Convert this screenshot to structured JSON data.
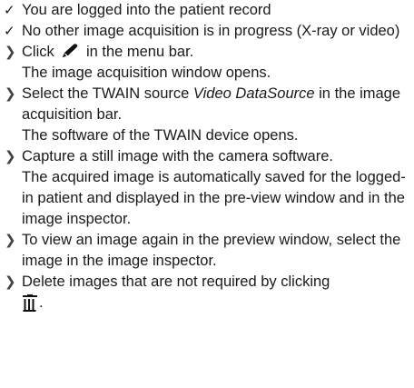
{
  "checks": [
    {
      "icon": "checkmark-icon",
      "text": "You are logged into the patient record"
    },
    {
      "icon": "checkmark-icon",
      "text": "No other image acquisition is in progress (X-ray or video)"
    }
  ],
  "steps": [
    {
      "icon": "chevron-right-icon",
      "before": "Click",
      "inline_icon": "pen-icon",
      "after": "in the menu bar.",
      "result": "The image acquisition window opens."
    },
    {
      "icon": "chevron-right-icon",
      "before": "Select the TWAIN source",
      "emphasis": "Video DataSource",
      "after": "in the image acquisition bar.",
      "result": "The software of the TWAIN device opens."
    },
    {
      "icon": "chevron-right-icon",
      "text": "Capture a still image with the camera software.",
      "result": "The acquired image is automatically saved for the logged-in patient and displayed in the pre-view window and in the image inspector."
    },
    {
      "icon": "chevron-right-icon",
      "text": "To view an image again in the preview window, select the image in the image inspector."
    },
    {
      "icon": "chevron-right-icon",
      "text": "Delete images that are not required by clicking",
      "inline_icon": "trash-icon",
      "after": "."
    }
  ]
}
